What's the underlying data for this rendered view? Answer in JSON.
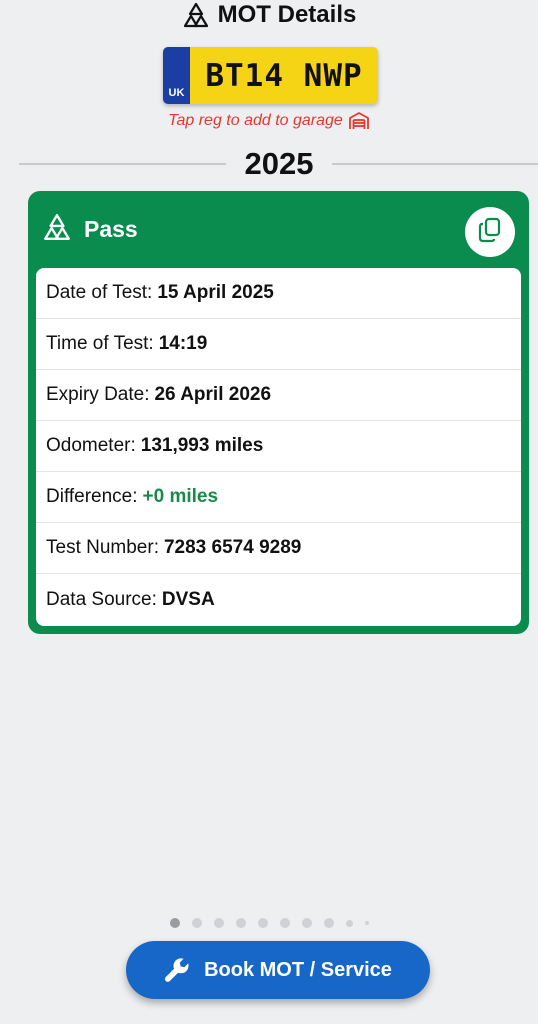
{
  "header": {
    "title": "MOT Details",
    "icon": "mot-triangles-icon"
  },
  "plate": {
    "country": "UK",
    "registration": "BT14 NWP"
  },
  "tap_hint": {
    "text": "Tap reg to add to garage",
    "icon": "garage-icon"
  },
  "year": "2025",
  "result": {
    "status": "Pass",
    "status_color": "#0a8c4e",
    "copy_icon": "copy-icon",
    "rows": [
      {
        "label": "Date of Test:",
        "value": "15 April 2025"
      },
      {
        "label": "Time of Test:",
        "value": "14:19"
      },
      {
        "label": "Expiry Date:",
        "value": "26 April 2026"
      },
      {
        "label": "Odometer:",
        "value": "131,993 miles"
      },
      {
        "label": "Difference:",
        "value": "+0 miles"
      },
      {
        "label": "Test Number:",
        "value": "7283 6574 9289"
      },
      {
        "label": "Data Source:",
        "value": "DVSA"
      }
    ]
  },
  "pagination": {
    "total": 10,
    "current": 1
  },
  "book_button": {
    "label": "Book MOT / Service",
    "icon": "wrench-icon",
    "color": "#1667c8"
  }
}
